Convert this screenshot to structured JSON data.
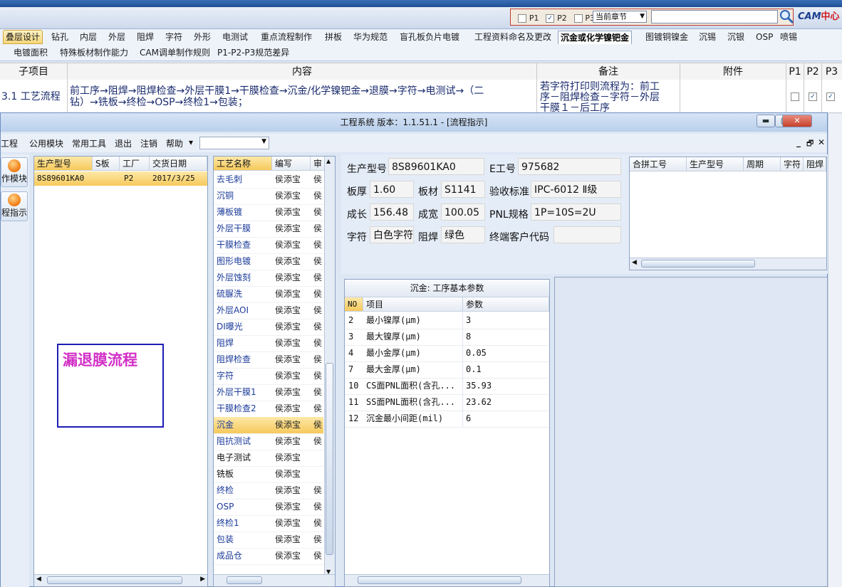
{
  "toolbar": {
    "filters": [
      {
        "label": "P1",
        "checked": false
      },
      {
        "label": "P2",
        "checked": true
      },
      {
        "label": "P3",
        "checked": false
      }
    ],
    "chapter_select": "当前章节",
    "search_placeholder": "",
    "logo_main": "CAM",
    "logo_accent": "中心"
  },
  "tabs_row1": [
    "叠层设计",
    "钻孔",
    "内层",
    "外层",
    "阻焊",
    "字符",
    "外形",
    "电测试",
    "重点流程制作",
    "拼板",
    "华为规范",
    "盲孔板负片电镀",
    "工程资料命名及更改",
    "沉金或化学镍钯金",
    "图镀铜镍金",
    "沉锡",
    "沉银",
    "OSP",
    "喷锡"
  ],
  "tabs_row1_active": "沉金或化学镍钯金",
  "tabs_row2": [
    "电镀面积",
    "特殊板材制作能力",
    "CAM调单制作规则",
    "P1-P2-P3规范差异"
  ],
  "bg_table": {
    "headers": [
      "子项目",
      "内容",
      "备注",
      "附件",
      "P1",
      "P2",
      "P3"
    ],
    "row": {
      "item": "3.1 工艺流程",
      "content_line1": "前工序→阻焊→阻焊检查→外层干膜1→干膜检查→沉金/化学镍钯金→退膜→字符→电测试→（二",
      "content_line2": "钻）→铣板→终检→OSP→终检1→包装；",
      "remark_line1": "若字符打印则流程为：前工",
      "remark_line2": "序－阻焊检查－字符－外层",
      "remark_line3": "干膜１－后工序",
      "p1": false,
      "p2": true,
      "p3": true
    }
  },
  "window": {
    "title": "工程系统   版本：1.1.51.1 - [流程指示]",
    "menu": [
      "工程",
      "公用模块",
      "常用工具",
      "退出",
      "注销",
      "帮助"
    ],
    "help_arrow": "▾",
    "icon_buttons": [
      "作模块",
      "程指示"
    ],
    "controls": {
      "min": "_",
      "restore": "🗗",
      "close": "✕"
    }
  },
  "orders": {
    "columns": [
      "生产型号",
      "S板",
      "工厂",
      "交货日期"
    ],
    "rows": [
      {
        "model": "8S89601KA0",
        "s": "",
        "factory": "P2",
        "date": "2017/3/25"
      }
    ]
  },
  "note_box": "漏退膜流程",
  "processes": {
    "columns": [
      "工艺名称",
      "编写",
      "审"
    ],
    "rows": [
      {
        "name": "去毛刺",
        "author": "侯添宝",
        "rev": "侯"
      },
      {
        "name": "沉铜",
        "author": "侯添宝",
        "rev": "侯"
      },
      {
        "name": "薄板镀",
        "author": "侯添宝",
        "rev": "侯"
      },
      {
        "name": "外层干膜",
        "author": "侯添宝",
        "rev": "侯"
      },
      {
        "name": "干膜检查",
        "author": "侯添宝",
        "rev": "侯"
      },
      {
        "name": "图形电镀",
        "author": "侯添宝",
        "rev": "侯"
      },
      {
        "name": "外层蚀刻",
        "author": "侯添宝",
        "rev": "侯"
      },
      {
        "name": "硫脲洗",
        "author": "侯添宝",
        "rev": "侯"
      },
      {
        "name": "外层AOI",
        "author": "侯添宝",
        "rev": "侯"
      },
      {
        "name": "DI曝光",
        "author": "侯添宝",
        "rev": "侯"
      },
      {
        "name": "阻焊",
        "author": "侯添宝",
        "rev": "侯"
      },
      {
        "name": "阻焊检查",
        "author": "侯添宝",
        "rev": "侯"
      },
      {
        "name": "字符",
        "author": "侯添宝",
        "rev": "侯"
      },
      {
        "name": "外层干膜1",
        "author": "侯添宝",
        "rev": "侯"
      },
      {
        "name": "干膜检查2",
        "author": "侯添宝",
        "rev": "侯"
      },
      {
        "name": "沉金",
        "author": "侯添宝",
        "rev": "侯",
        "selected": true
      },
      {
        "name": "阻抗测试",
        "author": "侯添宝",
        "rev": "侯"
      },
      {
        "name": "电子测试",
        "author": "侯添宝",
        "rev": "",
        "black": true
      },
      {
        "name": "铣板",
        "author": "侯添宝",
        "rev": "",
        "black": true
      },
      {
        "name": "终检",
        "author": "侯添宝",
        "rev": "侯"
      },
      {
        "name": "OSP",
        "author": "侯添宝",
        "rev": "侯"
      },
      {
        "name": "终检1",
        "author": "侯添宝",
        "rev": "侯"
      },
      {
        "name": "包装",
        "author": "侯添宝",
        "rev": "侯"
      },
      {
        "name": "成品仓",
        "author": "侯添宝",
        "rev": "侯"
      }
    ]
  },
  "info": {
    "model_label": "生产型号",
    "model": "8S89601KA0",
    "eno_label": "E工号",
    "eno": "975682",
    "thick_label": "板厚",
    "thick": "1.60",
    "mat_label": "板材",
    "mat": "S1141",
    "std_label": "验收标准",
    "std": "IPC-6012 Ⅱ级",
    "len_label": "成长",
    "len": "156.48",
    "wid_label": "成宽",
    "wid": "100.05",
    "pnl_label": "PNL规格",
    "pnl": "1P=10S=2U",
    "char_label": "字符",
    "char": "白色字符",
    "sm_label": "阻焊",
    "sm": "绿色",
    "cust_label": "终端客户代码",
    "cust": ""
  },
  "merge": {
    "columns": [
      "合拼工号",
      "生产型号",
      "周期",
      "字符",
      "阻焊"
    ]
  },
  "params": {
    "title": "沉金: 工序基本参数",
    "columns": [
      "NO",
      "项目",
      "参数"
    ],
    "rows": [
      {
        "no": "2",
        "item": "最小镍厚(μm)",
        "value": "3"
      },
      {
        "no": "3",
        "item": "最大镍厚(μm)",
        "value": "8"
      },
      {
        "no": "4",
        "item": "最小金厚(μm)",
        "value": "0.05"
      },
      {
        "no": "7",
        "item": "最大金厚(μm)",
        "value": "0.1"
      },
      {
        "no": "10",
        "item": "CS面PNL面积(含孔...",
        "value": "35.93"
      },
      {
        "no": "11",
        "item": "SS面PNL面积(含孔...",
        "value": "23.62"
      },
      {
        "no": "12",
        "item": "沉金最小间距(mil)",
        "value": "6"
      }
    ]
  }
}
